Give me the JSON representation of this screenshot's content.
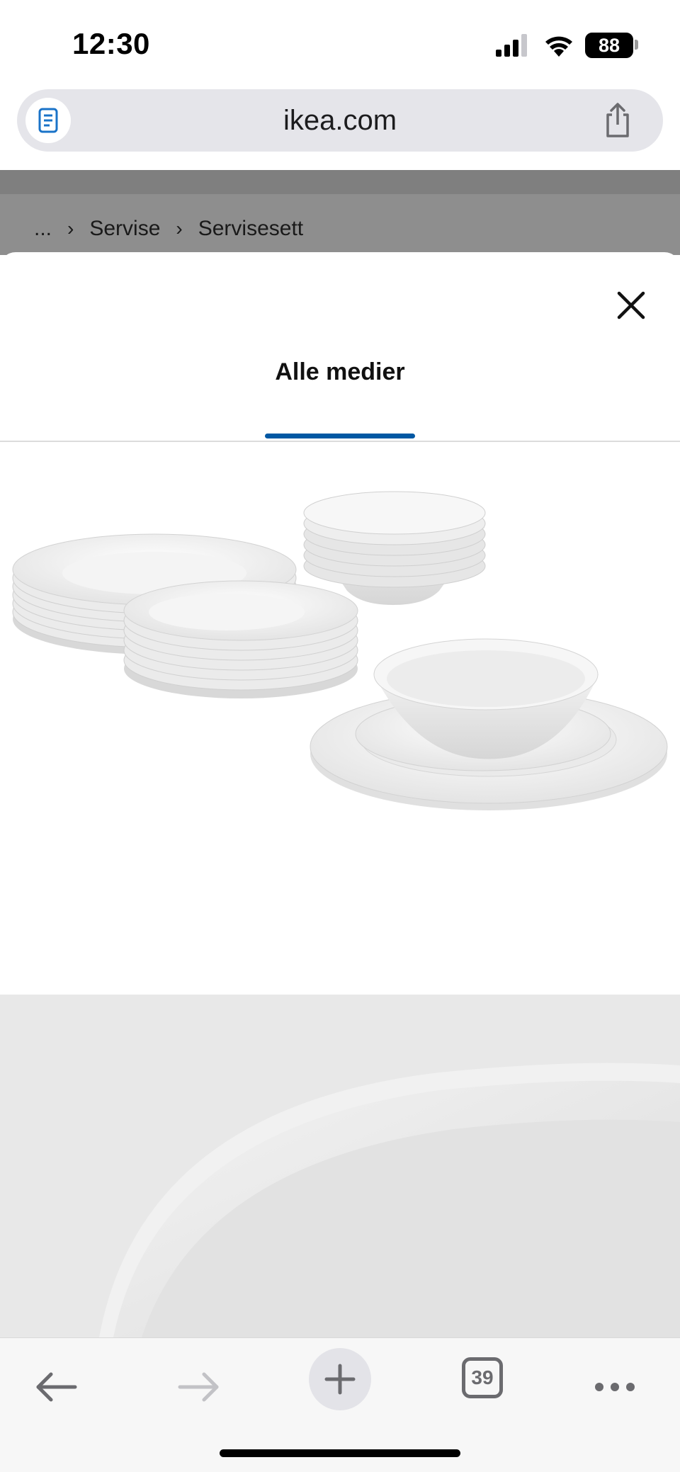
{
  "status_bar": {
    "time": "12:30",
    "battery": "88",
    "icons": [
      "cellular-signal-icon",
      "wifi-icon",
      "battery-icon"
    ]
  },
  "browser": {
    "url": "ikea.com",
    "reader_icon": "reader-mode-icon",
    "share_icon": "share-icon"
  },
  "breadcrumb": {
    "ellipsis": "...",
    "items": [
      "Servise",
      "Servisesett"
    ]
  },
  "media_modal": {
    "close_icon": "close-icon",
    "tab_label": "Alle medier",
    "accent_color": "#0058a3",
    "images": [
      "dinnerware-set-photo",
      "bowl-closeup-photo"
    ]
  },
  "toolbar": {
    "back_icon": "arrow-left-icon",
    "forward_icon": "arrow-right-icon",
    "new_tab_icon": "plus-icon",
    "tab_count": "39",
    "more_icon": "more-icon"
  }
}
